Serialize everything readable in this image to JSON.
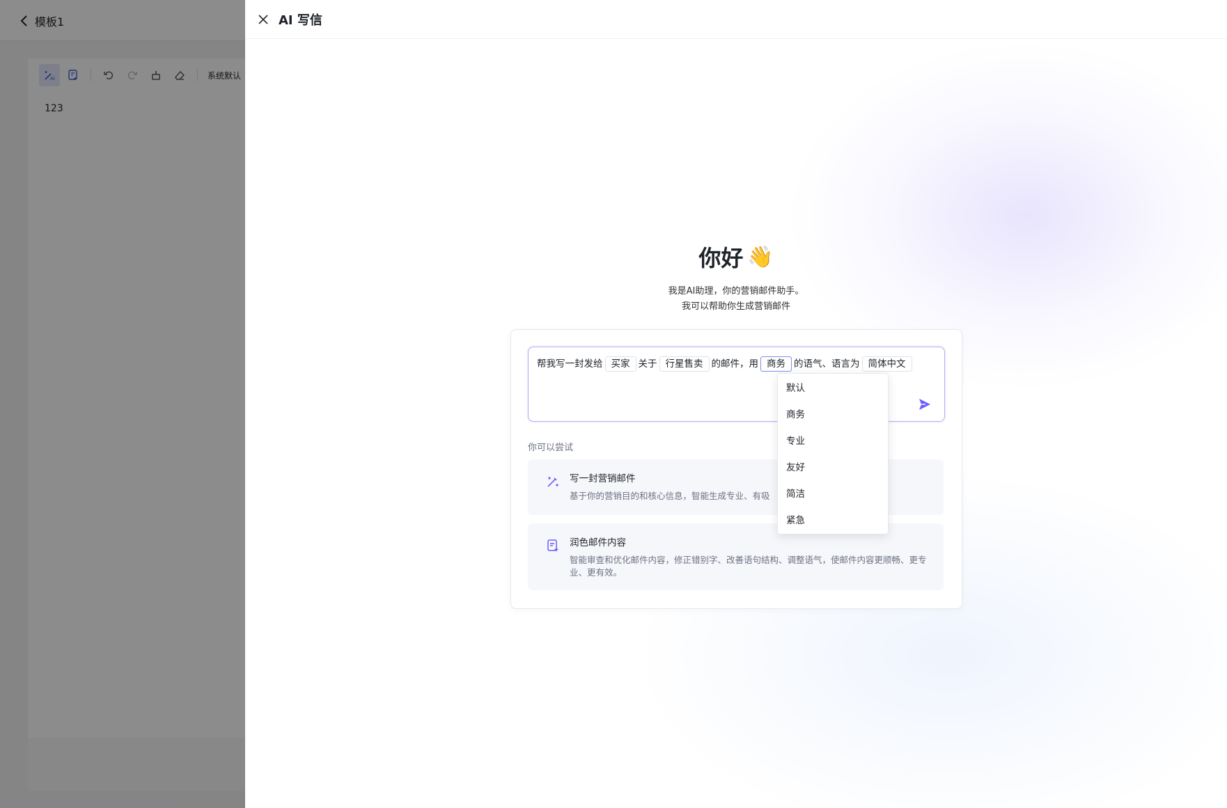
{
  "background": {
    "back_label": "模板1",
    "toolbar_font": "系统默认",
    "content_text": "123"
  },
  "drawer": {
    "title": "AI 写信",
    "greeting": "你好",
    "greeting_emoji": "👋",
    "intro_line1": "我是AI助理，你的营销邮件助手。",
    "intro_line2": "我可以帮助你生成营销邮件"
  },
  "prompt": {
    "t1": "帮我写一封发给",
    "chip_recipient": "买家",
    "t2": "关于",
    "chip_topic": "行星售卖",
    "t3": "的邮件，用",
    "chip_tone": "商务",
    "t4": "的语气、语言为",
    "chip_language": "简体中文"
  },
  "suggestions": {
    "label": "你可以尝试",
    "items": [
      {
        "title": "写一封营销邮件",
        "desc": "基于你的营销目的和核心信息，智能生成专业、有吸",
        "icon": "magic-wand-icon"
      },
      {
        "title": "润色邮件内容",
        "desc": "智能审查和优化邮件内容，修正错别字、改善语句结构、调整语气，使邮件内容更顺畅、更专业、更有效。",
        "icon": "document-edit-icon"
      }
    ]
  },
  "tone_dropdown": {
    "options": [
      "默认",
      "商务",
      "专业",
      "友好",
      "简洁",
      "紧急"
    ],
    "selected": "商务"
  },
  "colors": {
    "accent": "#6d5dfc",
    "overlay": "rgba(0,0,0,0.45)"
  }
}
